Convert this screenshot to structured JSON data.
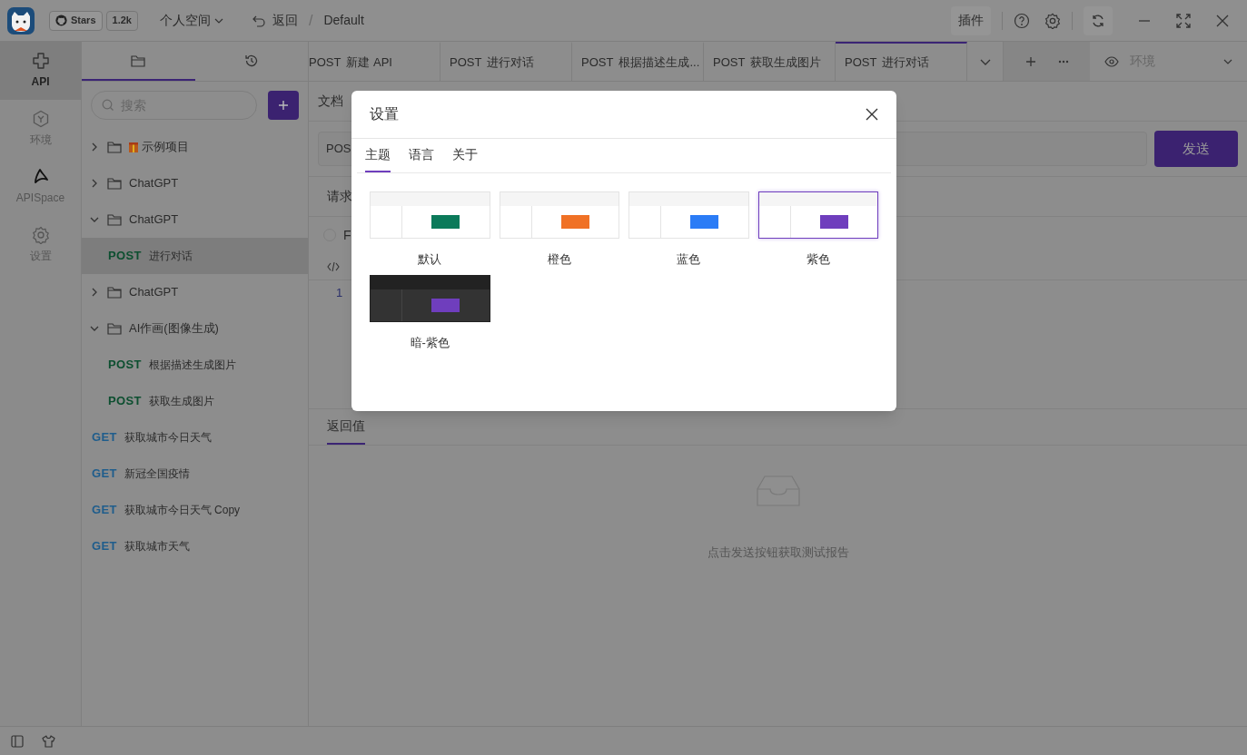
{
  "topbar": {
    "stars_label": "Stars",
    "stars_count": "1.2k",
    "workspace": "个人空间",
    "back": "返回",
    "separator": "/",
    "breadcrumb": "Default",
    "plugin": "插件"
  },
  "rail": [
    {
      "label": "API",
      "selected": true
    },
    {
      "label": "环境",
      "selected": false
    },
    {
      "label": "APISpace",
      "selected": false
    },
    {
      "label": "设置",
      "selected": false
    }
  ],
  "tree_tabs": [
    {
      "selected": true
    },
    {
      "selected": false
    }
  ],
  "search": {
    "placeholder": "搜索"
  },
  "tree": [
    {
      "kind": "folder",
      "label": "示例项目",
      "gift": true,
      "expanded": false,
      "selected": false
    },
    {
      "kind": "folder",
      "label": "ChatGPT",
      "gift": false,
      "expanded": false,
      "selected": false
    },
    {
      "kind": "folder",
      "label": "ChatGPT",
      "gift": false,
      "expanded": true,
      "selected": false,
      "children": [
        {
          "kind": "request",
          "method": "POST",
          "label": "进行对话",
          "selected": true
        }
      ]
    },
    {
      "kind": "folder",
      "label": "ChatGPT",
      "gift": false,
      "expanded": false,
      "selected": false
    },
    {
      "kind": "folder",
      "label": "AI作画(图像生成)",
      "gift": false,
      "expanded": true,
      "selected": false,
      "children": [
        {
          "kind": "request",
          "method": "POST",
          "label": "根据描述生成图片",
          "selected": false
        },
        {
          "kind": "request",
          "method": "POST",
          "label": "获取生成图片",
          "selected": false
        }
      ]
    },
    {
      "kind": "request",
      "method": "GET",
      "label": "获取城市今日天气",
      "selected": false
    },
    {
      "kind": "request",
      "method": "GET",
      "label": "新冠全国疫情",
      "selected": false
    },
    {
      "kind": "request",
      "method": "GET",
      "label": "获取城市今日天气 Copy",
      "selected": false
    },
    {
      "kind": "request",
      "method": "GET",
      "label": "获取城市天气",
      "selected": false
    }
  ],
  "request_tabs": [
    {
      "method": "POST",
      "label": "新建 API",
      "selected": false
    },
    {
      "method": "POST",
      "label": "进行对话",
      "selected": false
    },
    {
      "method": "POST",
      "label": "根据描述生成...",
      "selected": false
    },
    {
      "method": "POST",
      "label": "获取生成图片",
      "selected": false
    },
    {
      "method": "POST",
      "label": "进行对话",
      "selected": true
    }
  ],
  "environment": {
    "placeholder": "环境"
  },
  "main": {
    "doc_tab": "文档",
    "url_method": "POS",
    "send": "发送",
    "request_tab": "请求",
    "form_checked": false,
    "form_label": "F",
    "line_number": "1",
    "response_tab": "返回值",
    "empty_text": "点击发送按钮获取测试报告"
  },
  "dialog": {
    "title": "设置",
    "tabs": [
      {
        "label": "主题",
        "selected": true
      },
      {
        "label": "语言",
        "selected": false
      },
      {
        "label": "关于",
        "selected": false
      }
    ],
    "themes": [
      {
        "label": "默认",
        "kind": "light",
        "color": "#0b7a5a",
        "selected": false
      },
      {
        "label": "橙色",
        "kind": "light",
        "color": "#f07125",
        "selected": false
      },
      {
        "label": "蓝色",
        "kind": "light",
        "color": "#2b7cf6",
        "selected": false
      },
      {
        "label": "紫色",
        "kind": "light",
        "color": "#6f3ebd",
        "selected": true
      },
      {
        "label": "暗-紫色",
        "kind": "dark",
        "color": "#6f3ebd",
        "selected": false
      }
    ]
  }
}
